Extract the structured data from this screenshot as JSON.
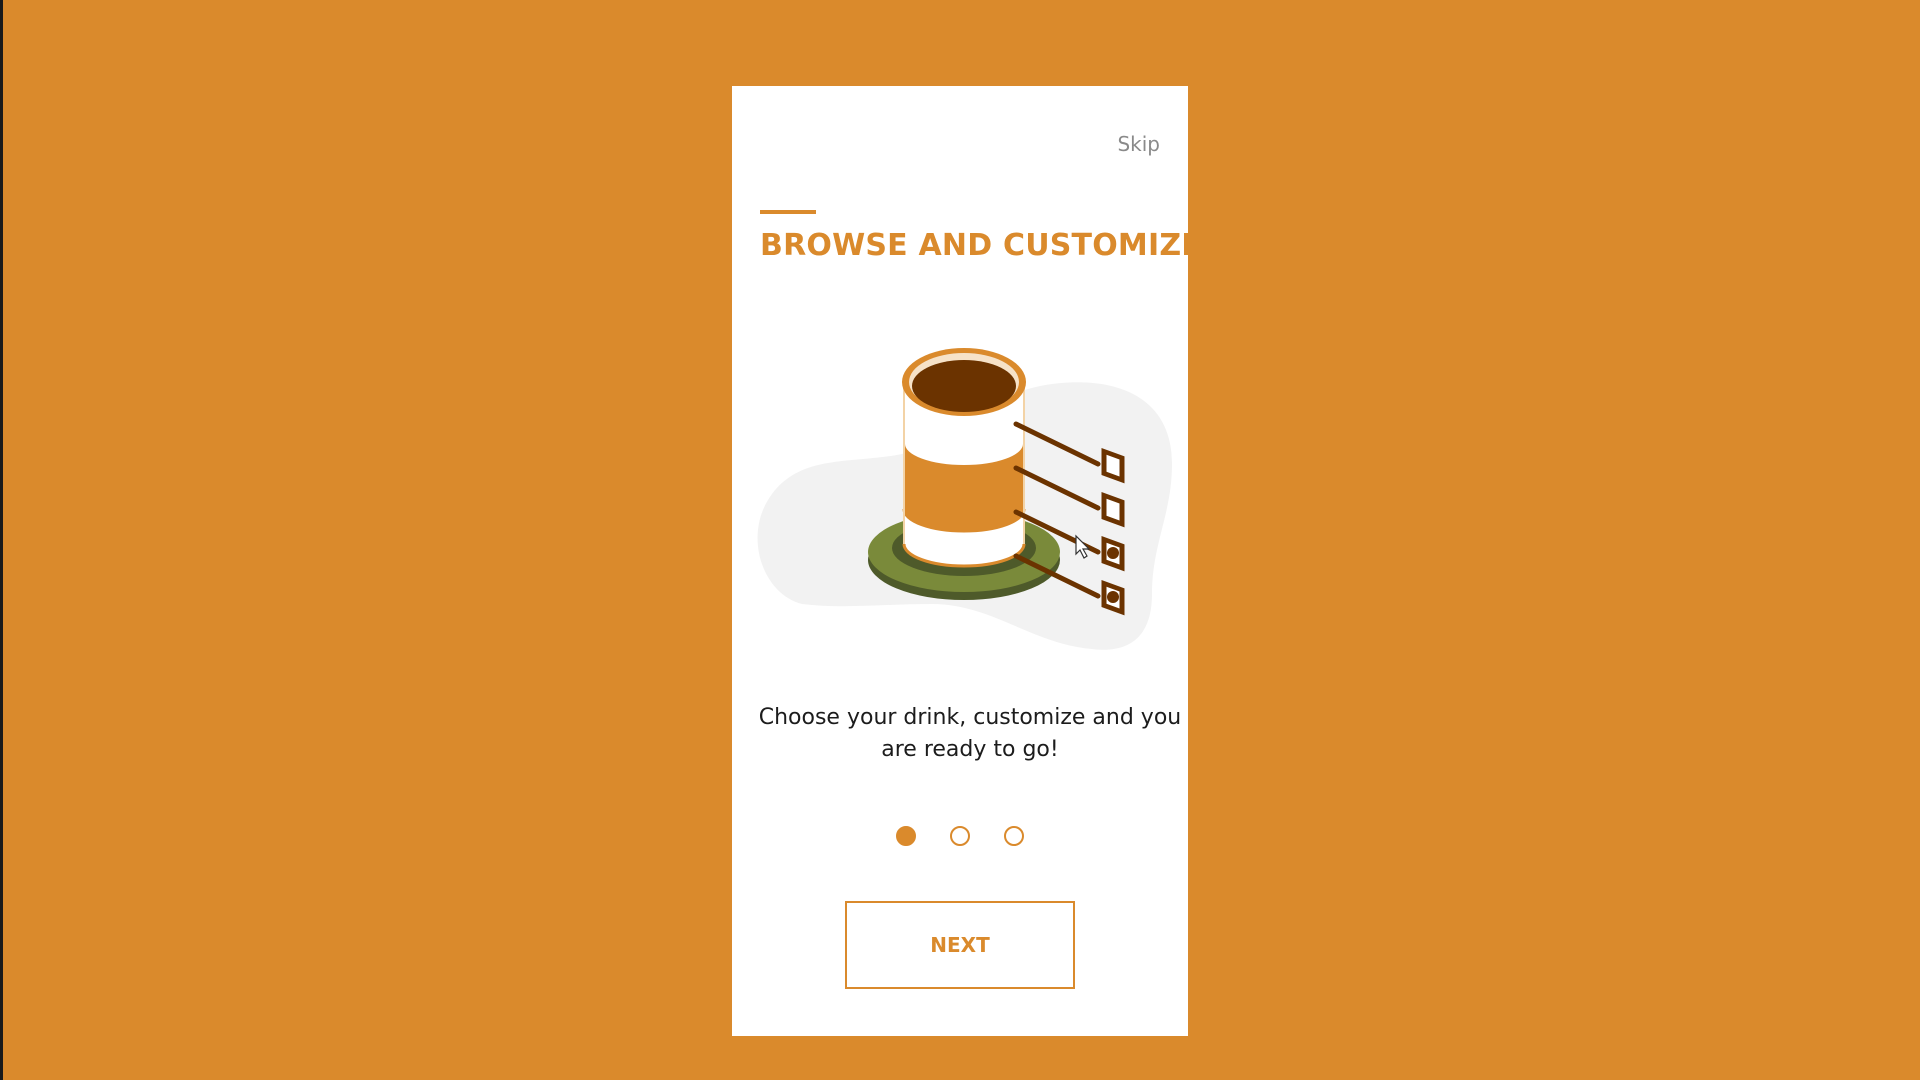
{
  "screen": {
    "skip_label": "Skip",
    "title": "BROWSE AND CUSTOMIZE",
    "description": "Choose your drink, customize and you are ready to go!",
    "next_label": "NEXT",
    "pagination": {
      "total": 3,
      "active": 1
    }
  },
  "colors": {
    "background": "#DA8A2C",
    "accent": "#DA8A2C",
    "coffee": "#6B3300",
    "saucer": "#7A8A3A",
    "saucer_dark": "#4E5A2A",
    "blob": "#F2F2F2"
  },
  "icons": {
    "illustration": "coffee-cup-checklist-illustration",
    "cursor": "mouse-pointer-icon"
  }
}
